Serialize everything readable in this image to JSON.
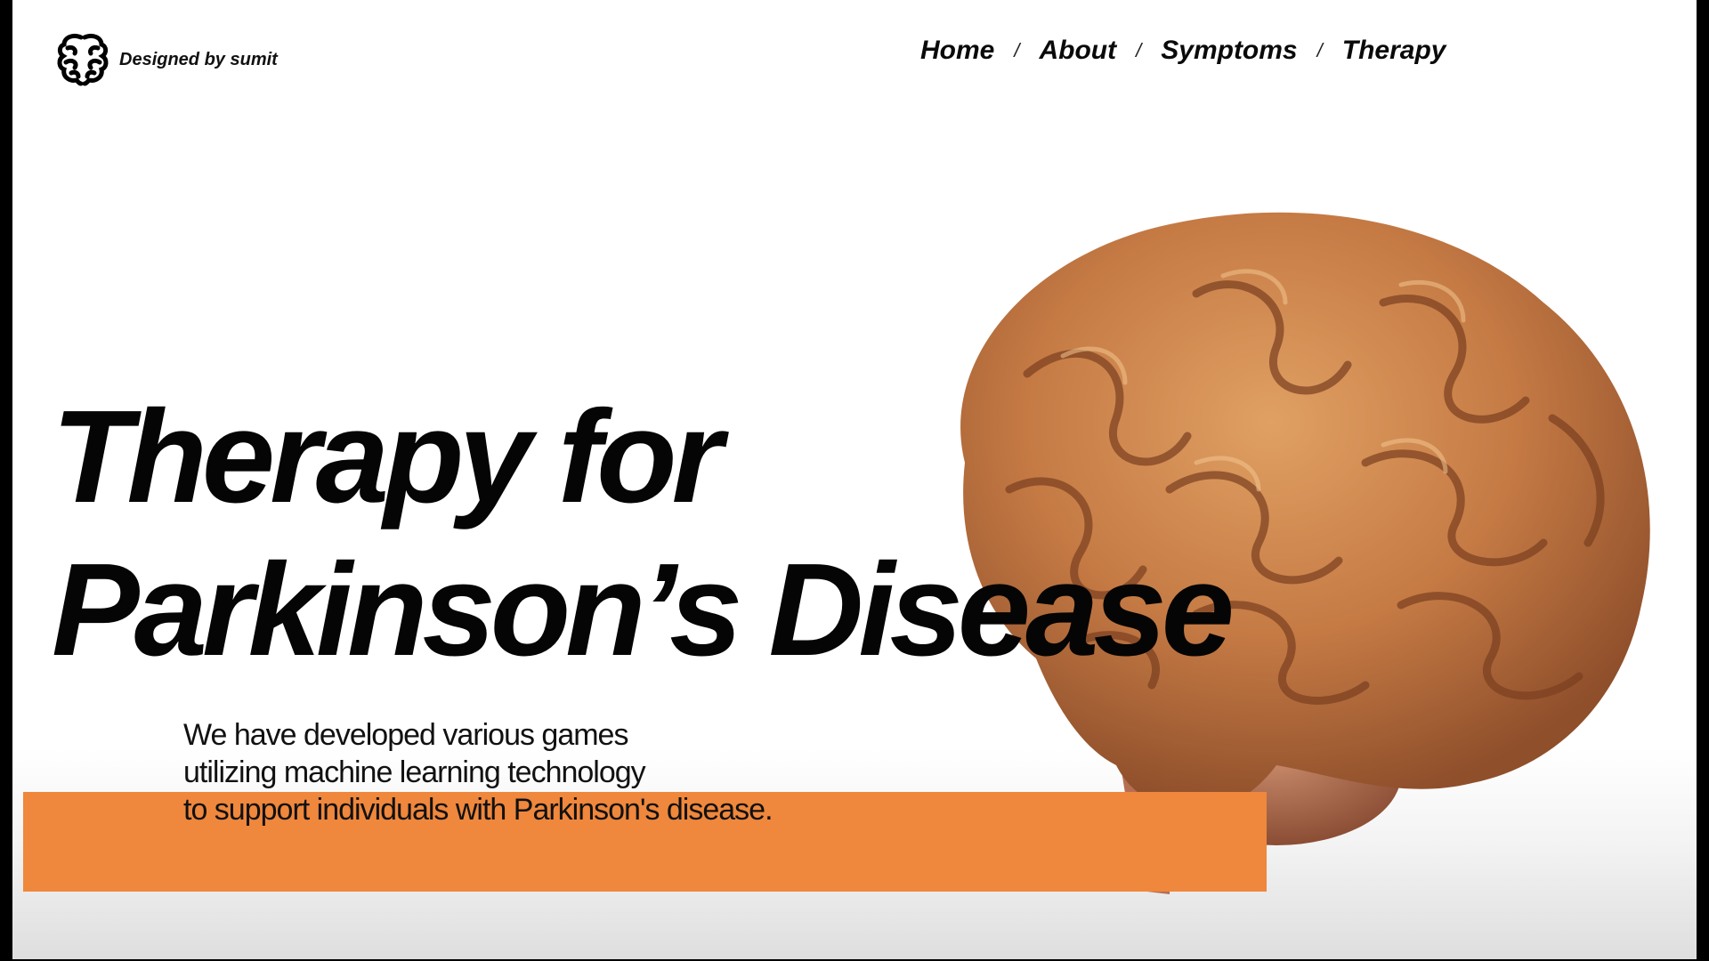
{
  "brand": {
    "text": "Designed by sumit",
    "logo_icon": "brain-logo-icon"
  },
  "nav": {
    "items": [
      {
        "label": "Home",
        "sep": "/"
      },
      {
        "label": "About",
        "sep": "/"
      },
      {
        "label": "Symptoms",
        "sep": "/"
      },
      {
        "label": "Therapy",
        "sep": ""
      }
    ]
  },
  "hero": {
    "title_line1": "Therapy for",
    "title_line2": "Parkinson’s Disease",
    "desc_line1": "We have developed various games",
    "desc_line2": "utilizing machine learning technology",
    "desc_line3": "to support individuals with Parkinson's disease."
  },
  "colors": {
    "accent": "#ef873c",
    "text": "#050505",
    "brain": "#c97a45"
  },
  "illustration": "brain-illustration"
}
